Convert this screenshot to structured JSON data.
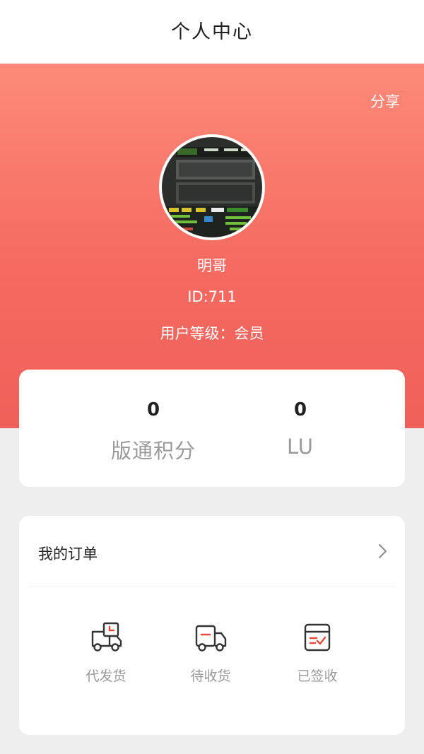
{
  "header": {
    "title": "个人中心"
  },
  "profile": {
    "share_label": "分享",
    "name": "明哥",
    "id_text": "ID:711",
    "level_text": "用户等级：会员"
  },
  "stats": [
    {
      "value": "0",
      "label": "版通积分"
    },
    {
      "value": "0",
      "label": "LU"
    }
  ],
  "orders": {
    "title": "我的订单",
    "items": [
      {
        "label": "代发货",
        "icon": "delivery-truck-clock-icon"
      },
      {
        "label": "待收货",
        "icon": "truck-icon"
      },
      {
        "label": "已签收",
        "icon": "signed-box-icon"
      }
    ]
  },
  "colors": {
    "hero_top": "#fd8b7a",
    "hero_bottom": "#f0605a",
    "background": "#eeeeee"
  }
}
